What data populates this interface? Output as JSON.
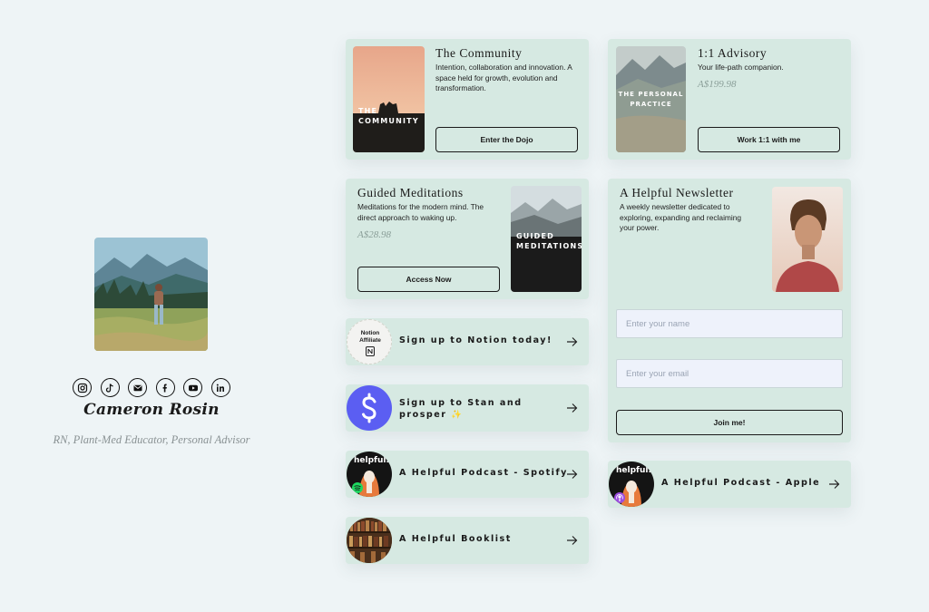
{
  "profile": {
    "name": "Cameron Rosin",
    "subtitle": "RN, Plant-Med Educator, Personal Advisor",
    "socials": [
      "instagram-icon",
      "tiktok-icon",
      "email-icon",
      "facebook-icon",
      "youtube-icon",
      "linkedin-icon"
    ]
  },
  "cards": {
    "community": {
      "title": "The Community",
      "desc": "Intention, collaboration and innovation. A space held for growth, evolution and transformation.",
      "thumb_line1": "THE",
      "thumb_line2": "COMMUNITY",
      "button": "Enter the Dojo"
    },
    "advisory": {
      "title": "1:1 Advisory",
      "desc": "Your life-path companion.",
      "price": "A$199.98",
      "thumb_line1": "THE PERSONAL",
      "thumb_line2": "PRACTICE",
      "button": "Work 1:1 with me"
    },
    "meditations": {
      "title": "Guided Meditations",
      "desc": "Meditations for the modern mind. The direct approach to waking up.",
      "price": "A$28.98",
      "thumb_line1": "GUIDED",
      "thumb_line2": "MEDITATIONS",
      "button": "Access Now"
    },
    "newsletter": {
      "title": "A Helpful Newsletter",
      "desc": "A weekly newsletter dedicated to exploring, expanding and reclaiming your power.",
      "name_placeholder": "Enter your name",
      "email_placeholder": "Enter your email",
      "button": "Join me!"
    }
  },
  "links": {
    "notion": {
      "label": "Sign up to Notion today!",
      "badge_line1": "Notion",
      "badge_line2": "Affiliate"
    },
    "stan": {
      "label": "Sign up to Stan and prosper ✨"
    },
    "spotify": {
      "label": "A Helpful Podcast - Spotify",
      "cover_text": "helpful."
    },
    "booklist": {
      "label": "A Helpful Booklist"
    },
    "apple": {
      "label": "A Helpful Podcast - Apple",
      "cover_text": "helpful."
    }
  },
  "colors": {
    "background": "#eef4f6",
    "card": "#d6e9e2",
    "stan_blue": "#5b5ef2"
  }
}
